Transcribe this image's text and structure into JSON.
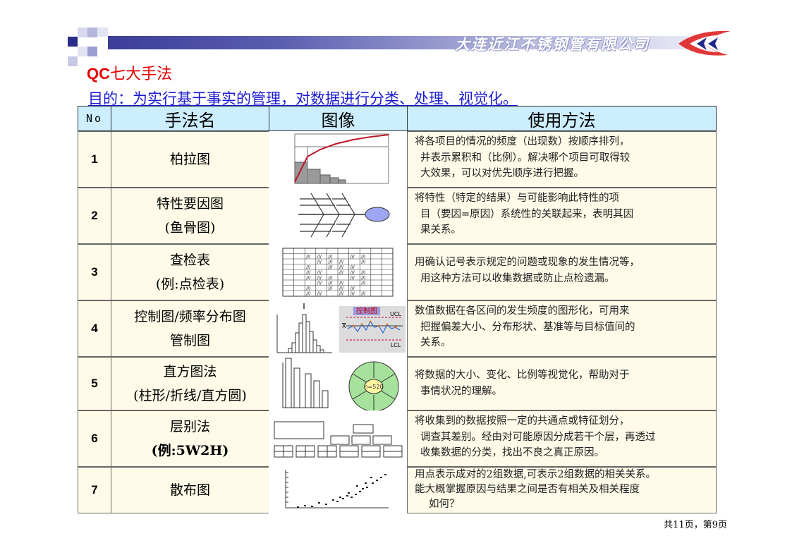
{
  "header": {
    "company": "大连近江不锈钢管有限公司"
  },
  "title_prefix": "QC",
  "title_cn": "七大手法",
  "purpose": "目的：为实行基于事实的管理，对数据进行分类、处理、视觉化。",
  "table": {
    "headers": [
      "No",
      "手法名",
      "图像",
      "使用方法"
    ],
    "rows": [
      {
        "no": "1",
        "name": [
          "柏拉图"
        ],
        "usage": [
          "将各项目的情况的频度（出现数）按顺序排列，",
          "并表示累积和（比例）。解决哪个项目可取得较",
          "大效果，可以对优先顺序进行把握。"
        ]
      },
      {
        "no": "2",
        "name": [
          "特性要因图",
          "(鱼骨图)"
        ],
        "usage": [
          "将特性（特定的结果）与可能影响此特性的项",
          "目（要因=原因）系统性的关联起来，表明其因",
          "果关系。"
        ]
      },
      {
        "no": "3",
        "name": [
          "查检表",
          "(例:点检表)"
        ],
        "usage": [
          "用确认记号表示规定的问题或现象的发生情况等，",
          "用这种方法可以收集数据或防止点检遗漏。"
        ]
      },
      {
        "no": "4",
        "name": [
          "控制图/频率分布图",
          "管制图"
        ],
        "usage": [
          "数值数据在各区间的发生频度的图形化，可用来",
          "把握偏差大小、分布形状、基准等与目标值间的",
          "关系。"
        ]
      },
      {
        "no": "5",
        "name": [
          "直方图法",
          "(柱形/折线/直方圆)"
        ],
        "usage": [
          "将数据的大小、变化、比例等视觉化，帮助对于",
          "事情状况的理解。"
        ]
      },
      {
        "no": "6",
        "name": [
          "层别法",
          "(例:5W2H)"
        ],
        "usage": [
          "将收集到的数据按照一定的共通点或特征划分，",
          "调查其差别。经由对可能原因分成若干个层，再透过",
          "收集数据的分类，找出不良之真正原因。"
        ]
      },
      {
        "no": "7",
        "name": [
          "散布图"
        ],
        "usage": [
          "用点表示成对的2组数据,可表示2组数据的相关关系。",
          "能大概掌握原因与结果之间是否有相关及相关程度",
          "如何？"
        ]
      }
    ]
  },
  "images": {
    "control_chart_label": "控制图",
    "ucl": "UCL",
    "lcl": "LCL",
    "xbar": "X",
    "pie_label": "n=520"
  },
  "footer": "共11页，第9页",
  "colors": {
    "title_red": "#e60000",
    "purpose_blue": "#1a1ad6",
    "header_fill": "#cceeff",
    "cell_fill": "#fffbe8",
    "banner": "#3b3d99"
  }
}
